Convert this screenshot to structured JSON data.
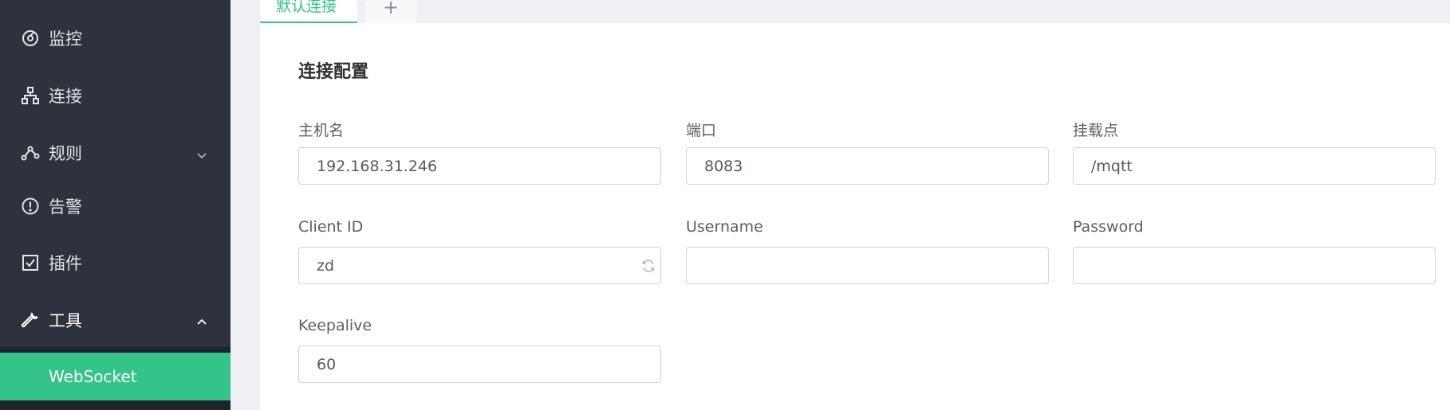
{
  "sidebar": {
    "items": [
      {
        "label": "监控",
        "icon": "dashboard-icon"
      },
      {
        "label": "连接",
        "icon": "cluster-icon"
      },
      {
        "label": "规则",
        "icon": "rule-icon"
      },
      {
        "label": "告警",
        "icon": "alert-icon"
      },
      {
        "label": "插件",
        "icon": "checkbox-icon"
      },
      {
        "label": "工具",
        "icon": "wrench-icon"
      }
    ],
    "submenu": {
      "label": "WebSocket"
    }
  },
  "tabs": {
    "active_label": "默认连接",
    "add_label": "+"
  },
  "form": {
    "title": "连接配置",
    "host": {
      "label": "主机名",
      "value": "192.168.31.246"
    },
    "port": {
      "label": "端口",
      "value": "8083"
    },
    "path": {
      "label": "挂载点",
      "value": "/mqtt"
    },
    "client_id": {
      "label": "Client ID",
      "value": "zd"
    },
    "username": {
      "label": "Username",
      "value": ""
    },
    "password": {
      "label": "Password",
      "value": ""
    },
    "keepalive": {
      "label": "Keepalive",
      "value": "60"
    }
  },
  "colors": {
    "sidebar_bg": "#2d323c",
    "accent": "#34c388",
    "page_bg": "#eef0f4"
  }
}
